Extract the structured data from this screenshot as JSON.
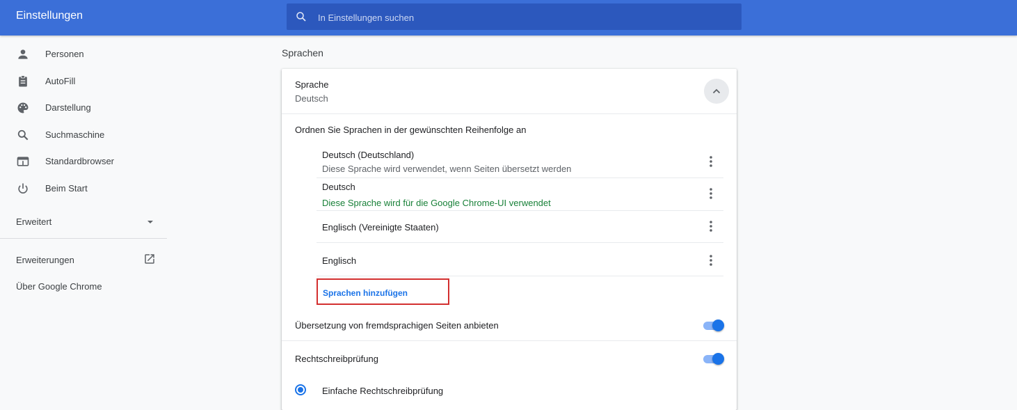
{
  "header": {
    "title": "Einstellungen",
    "search_placeholder": "In Einstellungen suchen"
  },
  "sidebar": {
    "items": [
      {
        "label": "Personen",
        "icon": "person-icon"
      },
      {
        "label": "AutoFill",
        "icon": "clipboard-icon"
      },
      {
        "label": "Darstellung",
        "icon": "palette-icon"
      },
      {
        "label": "Suchmaschine",
        "icon": "search-icon"
      },
      {
        "label": "Standardbrowser",
        "icon": "browser-window-icon"
      },
      {
        "label": "Beim Start",
        "icon": "power-icon"
      }
    ],
    "advanced_label": "Erweitert",
    "extensions_label": "Erweiterungen",
    "about_label": "Über Google Chrome"
  },
  "main": {
    "section_title": "Sprachen",
    "language": {
      "label": "Sprache",
      "value": "Deutsch"
    },
    "order_hint": "Ordnen Sie Sprachen in der gewünschten Reihenfolge an",
    "languages": [
      {
        "name": "Deutsch (Deutschland)",
        "note": "Diese Sprache wird verwendet, wenn Seiten übersetzt werden"
      },
      {
        "name": "Deutsch",
        "note": "Diese Sprache wird für die Google Chrome-UI verwendet"
      },
      {
        "name": "Englisch (Vereinigte Staaten)",
        "note": ""
      },
      {
        "name": "Englisch",
        "note": ""
      }
    ],
    "add_languages_label": "Sprachen hinzufügen",
    "translate_label": "Übersetzung von fremdsprachigen Seiten anbieten",
    "translate_enabled": true,
    "spellcheck_label": "Rechtschreibprüfung",
    "spellcheck_enabled": true,
    "spellcheck_option_label": "Einfache Rechtschreibprüfung",
    "spellcheck_option_selected": true
  },
  "colors": {
    "header_bg": "#3b6fd8",
    "search_bg": "#2c58bd",
    "accent": "#1a73e8",
    "ui_language_note": "#188038",
    "highlight_box": "#d32f2f"
  }
}
